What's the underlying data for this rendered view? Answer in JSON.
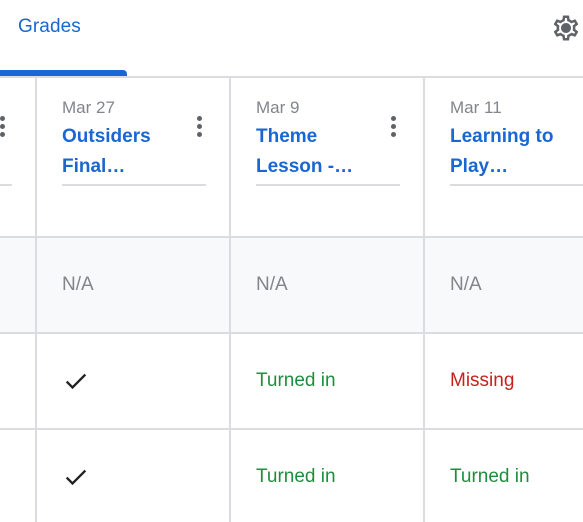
{
  "header": {
    "tab_label": "Grades",
    "settings_icon": "gear-icon"
  },
  "colors": {
    "accent": "#1967d2",
    "turned_in": "#1e8e3e",
    "missing": "#c5221f",
    "muted": "#80868b",
    "divider": "#dadce0"
  },
  "assignments": [
    {
      "date": "Mar 27",
      "title": "Outsiders Final…"
    },
    {
      "date": "Mar 9",
      "title": "Theme Lesson -…"
    },
    {
      "date": "Mar 11",
      "title": "Learning to Play…"
    }
  ],
  "class_average": [
    "N/A",
    "N/A",
    "N/A"
  ],
  "rows": [
    {
      "cells": [
        {
          "type": "check",
          "icon": "checkmark-icon"
        },
        {
          "type": "status",
          "text": "Turned in"
        },
        {
          "type": "status",
          "text": "Missing"
        }
      ]
    },
    {
      "cells": [
        {
          "type": "check",
          "icon": "checkmark-icon"
        },
        {
          "type": "status",
          "text": "Turned in"
        },
        {
          "type": "status",
          "text": "Turned in"
        }
      ]
    }
  ]
}
